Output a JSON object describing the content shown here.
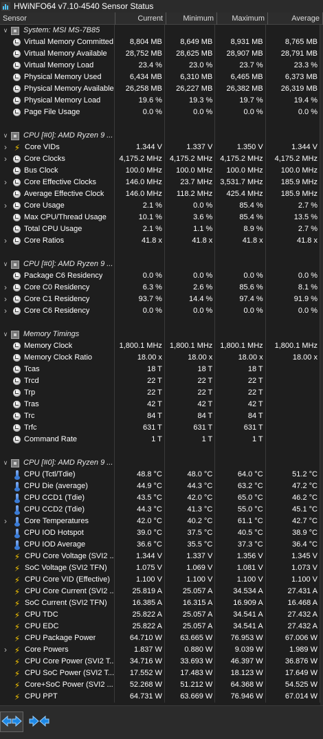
{
  "window": {
    "title": "HWiNFO64 v7.10-4540 Sensor Status"
  },
  "columns": [
    "Sensor",
    "Current",
    "Minimum",
    "Maximum",
    "Average"
  ],
  "rows": [
    {
      "type": "group",
      "label": "System: MSI MS-7B85"
    },
    {
      "type": "data",
      "icon": "clock",
      "label": "Virtual Memory Committed",
      "v": [
        "8,804 MB",
        "8,649 MB",
        "8,931 MB",
        "8,765 MB"
      ]
    },
    {
      "type": "data",
      "icon": "clock",
      "label": "Virtual Memory Available",
      "v": [
        "28,752 MB",
        "28,625 MB",
        "28,907 MB",
        "28,791 MB"
      ]
    },
    {
      "type": "data",
      "icon": "clock",
      "label": "Virtual Memory Load",
      "v": [
        "23.4 %",
        "23.0 %",
        "23.7 %",
        "23.3 %"
      ]
    },
    {
      "type": "data",
      "icon": "clock",
      "label": "Physical Memory Used",
      "v": [
        "6,434 MB",
        "6,310 MB",
        "6,465 MB",
        "6,373 MB"
      ]
    },
    {
      "type": "data",
      "icon": "clock",
      "label": "Physical Memory Available",
      "v": [
        "26,258 MB",
        "26,227 MB",
        "26,382 MB",
        "26,319 MB"
      ]
    },
    {
      "type": "data",
      "icon": "clock",
      "label": "Physical Memory Load",
      "v": [
        "19.6 %",
        "19.3 %",
        "19.7 %",
        "19.4 %"
      ]
    },
    {
      "type": "data",
      "icon": "clock",
      "label": "Page File Usage",
      "v": [
        "0.0 %",
        "0.0 %",
        "0.0 %",
        "0.0 %"
      ]
    },
    {
      "type": "blank"
    },
    {
      "type": "group",
      "label": "CPU [#0]: AMD Ryzen 9 ..."
    },
    {
      "type": "data",
      "expand": true,
      "icon": "bolt",
      "label": "Core VIDs",
      "v": [
        "1.344 V",
        "1.337 V",
        "1.350 V",
        "1.344 V"
      ]
    },
    {
      "type": "data",
      "expand": true,
      "icon": "clock",
      "label": "Core Clocks",
      "v": [
        "4,175.2 MHz",
        "4,175.2 MHz",
        "4,175.2 MHz",
        "4,175.2 MHz"
      ]
    },
    {
      "type": "data",
      "icon": "clock",
      "label": "Bus Clock",
      "v": [
        "100.0 MHz",
        "100.0 MHz",
        "100.0 MHz",
        "100.0 MHz"
      ]
    },
    {
      "type": "data",
      "expand": true,
      "icon": "clock",
      "label": "Core Effective Clocks",
      "v": [
        "146.0 MHz",
        "23.7 MHz",
        "3,531.7 MHz",
        "185.9 MHz"
      ]
    },
    {
      "type": "data",
      "icon": "clock",
      "label": "Average Effective Clock",
      "v": [
        "146.0 MHz",
        "118.2 MHz",
        "425.4 MHz",
        "185.9 MHz"
      ]
    },
    {
      "type": "data",
      "expand": true,
      "icon": "clock",
      "label": "Core Usage",
      "v": [
        "2.1 %",
        "0.0 %",
        "85.4 %",
        "2.7 %"
      ]
    },
    {
      "type": "data",
      "icon": "clock",
      "label": "Max CPU/Thread Usage",
      "v": [
        "10.1 %",
        "3.6 %",
        "85.4 %",
        "13.5 %"
      ]
    },
    {
      "type": "data",
      "icon": "clock",
      "label": "Total CPU Usage",
      "v": [
        "2.1 %",
        "1.1 %",
        "8.9 %",
        "2.7 %"
      ]
    },
    {
      "type": "data",
      "expand": true,
      "icon": "clock",
      "label": "Core Ratios",
      "v": [
        "41.8 x",
        "41.8 x",
        "41.8 x",
        "41.8 x"
      ]
    },
    {
      "type": "blank"
    },
    {
      "type": "group",
      "label": "CPU [#0]: AMD Ryzen 9 ..."
    },
    {
      "type": "data",
      "icon": "clock",
      "label": "Package C6 Residency",
      "v": [
        "0.0 %",
        "0.0 %",
        "0.0 %",
        "0.0 %"
      ]
    },
    {
      "type": "data",
      "expand": true,
      "icon": "clock",
      "label": "Core C0 Residency",
      "v": [
        "6.3 %",
        "2.6 %",
        "85.6 %",
        "8.1 %"
      ]
    },
    {
      "type": "data",
      "expand": true,
      "icon": "clock",
      "label": "Core C1 Residency",
      "v": [
        "93.7 %",
        "14.4 %",
        "97.4 %",
        "91.9 %"
      ]
    },
    {
      "type": "data",
      "expand": true,
      "icon": "clock",
      "label": "Core C6 Residency",
      "v": [
        "0.0 %",
        "0.0 %",
        "0.0 %",
        "0.0 %"
      ]
    },
    {
      "type": "blank"
    },
    {
      "type": "group",
      "label": "Memory Timings"
    },
    {
      "type": "data",
      "icon": "clock",
      "label": "Memory Clock",
      "v": [
        "1,800.1 MHz",
        "1,800.1 MHz",
        "1,800.1 MHz",
        "1,800.1 MHz"
      ]
    },
    {
      "type": "data",
      "icon": "clock",
      "label": "Memory Clock Ratio",
      "v": [
        "18.00 x",
        "18.00 x",
        "18.00 x",
        "18.00 x"
      ]
    },
    {
      "type": "data",
      "icon": "clock",
      "label": "Tcas",
      "v": [
        "18 T",
        "18 T",
        "18 T",
        ""
      ]
    },
    {
      "type": "data",
      "icon": "clock",
      "label": "Trcd",
      "v": [
        "22 T",
        "22 T",
        "22 T",
        ""
      ]
    },
    {
      "type": "data",
      "icon": "clock",
      "label": "Trp",
      "v": [
        "22 T",
        "22 T",
        "22 T",
        ""
      ]
    },
    {
      "type": "data",
      "icon": "clock",
      "label": "Tras",
      "v": [
        "42 T",
        "42 T",
        "42 T",
        ""
      ]
    },
    {
      "type": "data",
      "icon": "clock",
      "label": "Trc",
      "v": [
        "84 T",
        "84 T",
        "84 T",
        ""
      ]
    },
    {
      "type": "data",
      "icon": "clock",
      "label": "Trfc",
      "v": [
        "631 T",
        "631 T",
        "631 T",
        ""
      ]
    },
    {
      "type": "data",
      "icon": "clock",
      "label": "Command Rate",
      "v": [
        "1 T",
        "1 T",
        "1 T",
        ""
      ]
    },
    {
      "type": "blank"
    },
    {
      "type": "group",
      "label": "CPU [#0]: AMD Ryzen 9 ..."
    },
    {
      "type": "data",
      "icon": "therm",
      "label": "CPU (Tctl/Tdie)",
      "v": [
        "48.8 °C",
        "48.0 °C",
        "64.0 °C",
        "51.2 °C"
      ]
    },
    {
      "type": "data",
      "icon": "therm",
      "label": "CPU Die (average)",
      "v": [
        "44.9 °C",
        "44.3 °C",
        "63.2 °C",
        "47.2 °C"
      ]
    },
    {
      "type": "data",
      "icon": "therm",
      "label": "CPU CCD1 (Tdie)",
      "v": [
        "43.5 °C",
        "42.0 °C",
        "65.0 °C",
        "46.2 °C"
      ]
    },
    {
      "type": "data",
      "icon": "therm",
      "label": "CPU CCD2 (Tdie)",
      "v": [
        "44.3 °C",
        "41.3 °C",
        "55.0 °C",
        "45.1 °C"
      ]
    },
    {
      "type": "data",
      "expand": true,
      "icon": "therm",
      "label": "Core Temperatures",
      "v": [
        "42.0 °C",
        "40.2 °C",
        "61.1 °C",
        "42.7 °C"
      ]
    },
    {
      "type": "data",
      "icon": "therm",
      "label": "CPU IOD Hotspot",
      "v": [
        "39.0 °C",
        "37.5 °C",
        "40.5 °C",
        "38.9 °C"
      ]
    },
    {
      "type": "data",
      "icon": "therm",
      "label": "CPU IOD Average",
      "v": [
        "36.6 °C",
        "35.5 °C",
        "37.3 °C",
        "36.4 °C"
      ]
    },
    {
      "type": "data",
      "icon": "bolt",
      "label": "CPU Core Voltage (SVI2 ...",
      "v": [
        "1.344 V",
        "1.337 V",
        "1.356 V",
        "1.345 V"
      ]
    },
    {
      "type": "data",
      "icon": "bolt",
      "label": "SoC Voltage (SVI2 TFN)",
      "v": [
        "1.075 V",
        "1.069 V",
        "1.081 V",
        "1.073 V"
      ]
    },
    {
      "type": "data",
      "icon": "bolt",
      "label": "CPU Core VID (Effective)",
      "v": [
        "1.100 V",
        "1.100 V",
        "1.100 V",
        "1.100 V"
      ]
    },
    {
      "type": "data",
      "icon": "bolt",
      "label": "CPU Core Current (SVI2 ...",
      "v": [
        "25.819 A",
        "25.057 A",
        "34.534 A",
        "27.431 A"
      ]
    },
    {
      "type": "data",
      "icon": "bolt",
      "label": "SoC Current (SVI2 TFN)",
      "v": [
        "16.385 A",
        "16.315 A",
        "16.909 A",
        "16.468 A"
      ]
    },
    {
      "type": "data",
      "icon": "bolt",
      "label": "CPU TDC",
      "v": [
        "25.822 A",
        "25.057 A",
        "34.541 A",
        "27.432 A"
      ]
    },
    {
      "type": "data",
      "icon": "bolt",
      "label": "CPU EDC",
      "v": [
        "25.822 A",
        "25.057 A",
        "34.541 A",
        "27.432 A"
      ]
    },
    {
      "type": "data",
      "icon": "bolt",
      "label": "CPU Package Power",
      "v": [
        "64.710 W",
        "63.665 W",
        "76.953 W",
        "67.006 W"
      ]
    },
    {
      "type": "data",
      "expand": true,
      "icon": "bolt",
      "label": "Core Powers",
      "v": [
        "1.837 W",
        "0.880 W",
        "9.039 W",
        "1.989 W"
      ]
    },
    {
      "type": "data",
      "icon": "bolt",
      "label": "CPU Core Power (SVI2 T...",
      "v": [
        "34.716 W",
        "33.693 W",
        "46.397 W",
        "36.876 W"
      ]
    },
    {
      "type": "data",
      "icon": "bolt",
      "label": "CPU SoC Power (SVI2 T...",
      "v": [
        "17.552 W",
        "17.483 W",
        "18.123 W",
        "17.649 W"
      ]
    },
    {
      "type": "data",
      "icon": "bolt",
      "label": "Core+SoC Power (SVI2 ...",
      "v": [
        "52.268 W",
        "51.212 W",
        "64.368 W",
        "54.525 W"
      ]
    },
    {
      "type": "data",
      "icon": "bolt",
      "label": "CPU PPT",
      "v": [
        "64.731 W",
        "63.669 W",
        "76.946 W",
        "67.014 W"
      ]
    }
  ],
  "toolbar": {
    "buttons": [
      "arrows-left-right-icon",
      "arrows-collapse-icon"
    ]
  }
}
